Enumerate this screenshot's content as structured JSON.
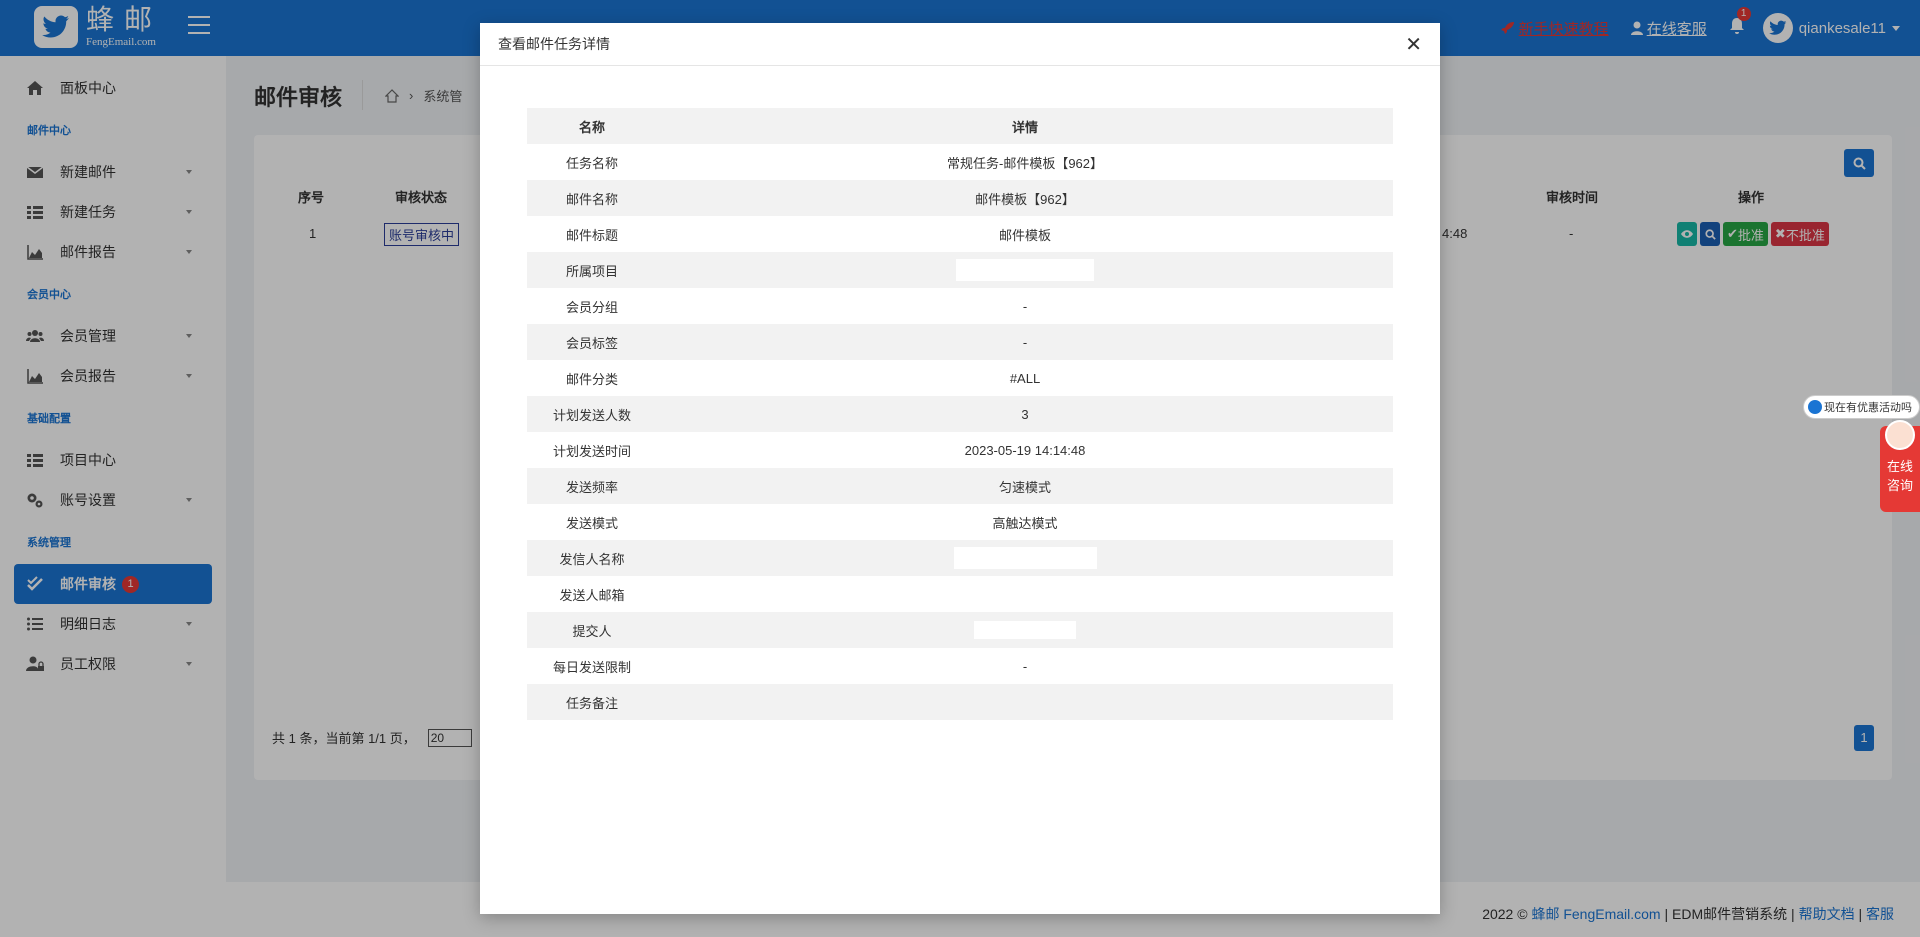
{
  "header": {
    "logo_cn": "蜂邮",
    "logo_en": "FengEmail.com",
    "links": [
      {
        "label": "新手快速教程",
        "color": "#e53935"
      },
      {
        "label": "在线客服"
      }
    ],
    "notification_count": "1",
    "username": "qiankesale11"
  },
  "sidebar": {
    "dashboard": "面板中心",
    "groups": [
      "邮件中心",
      "会员中心",
      "基础配置",
      "系统管理"
    ],
    "items": {
      "new_email": "新建邮件",
      "new_task": "新建任务",
      "email_report": "邮件报告",
      "member_manage": "会员管理",
      "member_report": "会员报告",
      "project_center": "项目中心",
      "account_settings": "账号设置",
      "email_review": "邮件审核",
      "email_review_badge": "1",
      "detail_log": "明细日志",
      "staff_perms": "员工权限"
    }
  },
  "main": {
    "title": "邮件审核",
    "breadcrumb": "系统管",
    "table": {
      "headers": {
        "seq": "序号",
        "status": "审核状态",
        "review_time_col": "审核时间",
        "ops": "操作"
      },
      "row": {
        "seq": "1",
        "status": "账号审核中",
        "time_fragment": "4:48",
        "review_time": "-"
      },
      "op_labels": {
        "approve": "批准",
        "reject": "不批准"
      }
    },
    "pager": {
      "text": "共 1 条，当前第 1/1 页，",
      "page_size": "20",
      "current_page": "1"
    }
  },
  "footer": {
    "prefix": "2022 ©",
    "brand": "蜂邮 FengEmail.com",
    "system": "EDM邮件营销系统",
    "help": "帮助文档",
    "service": "客服"
  },
  "float": {
    "bubble": "现在有优惠活动吗",
    "consult_1": "在线",
    "consult_2": "咨询"
  },
  "modal": {
    "title": "查看邮件任务详情",
    "col_name": "名称",
    "col_detail": "详情",
    "rows": [
      {
        "name": "任务名称",
        "value": "常规任务-邮件模板【962】"
      },
      {
        "name": "邮件名称",
        "value": "邮件模板【962】"
      },
      {
        "name": "邮件标题",
        "value": "邮件模板"
      },
      {
        "name": "所属项目",
        "value": ""
      },
      {
        "name": "会员分组",
        "value": "-"
      },
      {
        "name": "会员标签",
        "value": "-"
      },
      {
        "name": "邮件分类",
        "value": "#ALL"
      },
      {
        "name": "计划发送人数",
        "value": "3"
      },
      {
        "name": "计划发送时间",
        "value": "2023-05-19 14:14:48"
      },
      {
        "name": "发送频率",
        "value": "匀速模式"
      },
      {
        "name": "发送模式",
        "value": "高触达模式"
      },
      {
        "name": "发信人名称",
        "value": ""
      },
      {
        "name": "发送人邮箱",
        "value": ""
      },
      {
        "name": "提交人",
        "value": ""
      },
      {
        "name": "每日发送限制",
        "value": "-"
      },
      {
        "name": "任务备注",
        "value": ""
      }
    ]
  }
}
